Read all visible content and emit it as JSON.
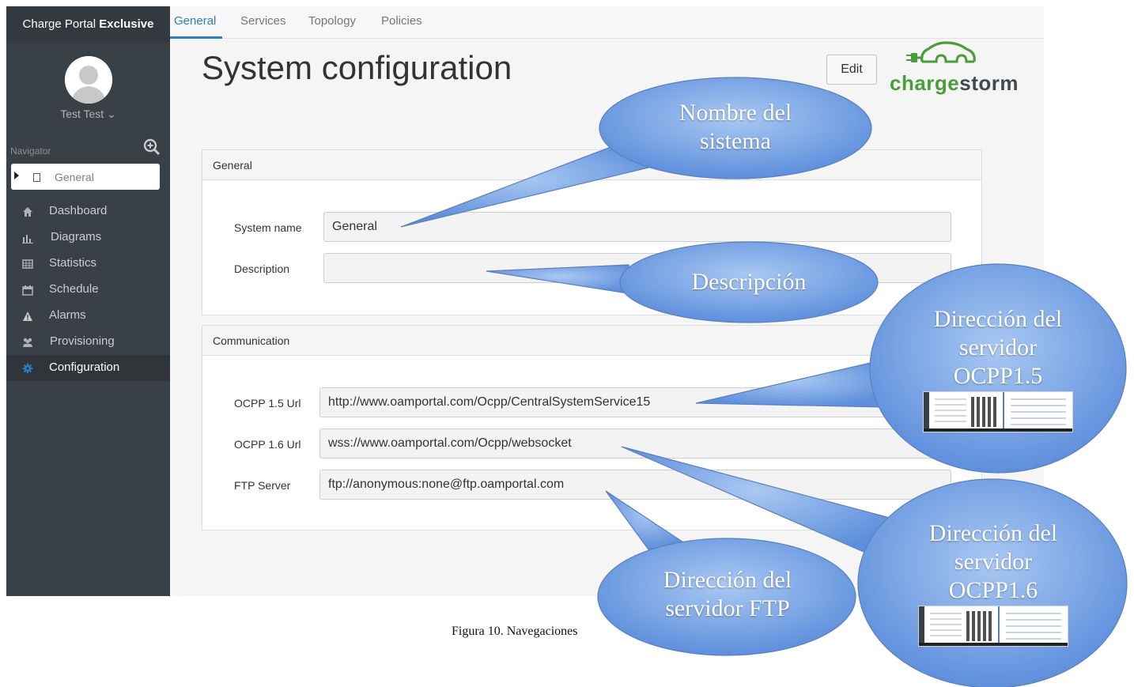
{
  "sidebar": {
    "brand_normal": "Charge Portal ",
    "brand_bold": "Exclusive",
    "user_name": "Test Test ⌄",
    "navigator_label": "Navigator",
    "current_item": "General",
    "menu": [
      {
        "label": "Dashboard",
        "icon": "home-icon"
      },
      {
        "label": "Diagrams",
        "icon": "bar-chart-icon"
      },
      {
        "label": "Statistics",
        "icon": "table-icon"
      },
      {
        "label": "Schedule",
        "icon": "calendar-icon"
      },
      {
        "label": "Alarms",
        "icon": "warning-icon"
      },
      {
        "label": "Provisioning",
        "icon": "users-icon"
      },
      {
        "label": "Configuration",
        "icon": "gear-icon"
      }
    ]
  },
  "tabs": [
    "General",
    "Services",
    "Topology",
    "Policies"
  ],
  "page": {
    "title": "System configuration",
    "edit_label": "Edit",
    "logo_green": "charge",
    "logo_dark": "storm"
  },
  "general_panel": {
    "header": "General",
    "system_name_label": "System name",
    "system_name_value": "General",
    "description_label": "Description",
    "description_value": ""
  },
  "communication_panel": {
    "header": "Communication",
    "ocpp15_label": "OCPP 1.5 Url",
    "ocpp15_value": "http://www.oamportal.com/Ocpp/CentralSystemService15",
    "ocpp16_label": "OCPP 1.6 Url",
    "ocpp16_value": "wss://www.oamportal.com/Ocpp/websocket",
    "ftp_label": "FTP Server",
    "ftp_value": "ftp://anonymous:none@ftp.oamportal.com"
  },
  "callouts": {
    "name_line1": "Nombre del",
    "name_line2": "sistema",
    "description": "Descripción",
    "ocpp15_line1": "Dirección del",
    "ocpp15_line2": "servidor",
    "ocpp15_line3": "OCPP1.5",
    "ocpp16_line1": "Dirección del",
    "ocpp16_line2": "servidor",
    "ocpp16_line3": "OCPP1.6",
    "ftp_line1": "Dirección del",
    "ftp_line2": "servidor FTP"
  },
  "caption": "Figura 10. Navegaciones",
  "colors": {
    "accent": "#2a7fc7",
    "sidebar": "#3a4146",
    "callout_fill": "#6e9be0",
    "logo_green": "#4b9d3a"
  }
}
